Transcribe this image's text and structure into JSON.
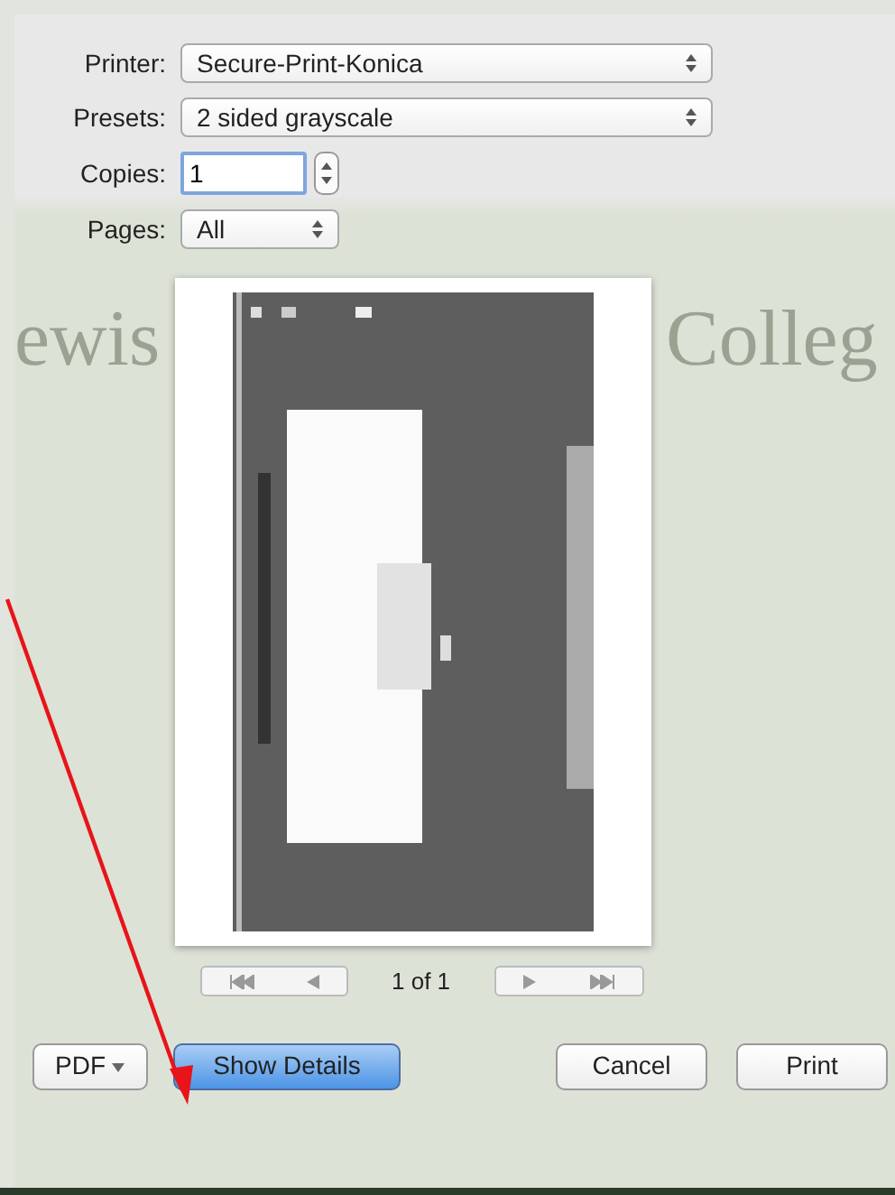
{
  "fields": [
    {
      "kind": "select",
      "label": "Printer:",
      "value": "Secure-Print-Konica",
      "wide": true
    },
    {
      "kind": "select",
      "label": "Presets:",
      "value": "2 sided grayscale",
      "wide": true
    },
    {
      "kind": "number",
      "label": "Copies:",
      "value": "1"
    },
    {
      "kind": "select",
      "label": "Pages:",
      "value": "All",
      "wide": false
    }
  ],
  "background_heading": {
    "left": "ewis",
    "right": "Colleg"
  },
  "preview": {
    "kind": "picture",
    "page_indicator": "1 of 1"
  },
  "buttons": [
    {
      "label": "PDF",
      "kind": "menu"
    },
    {
      "label": "Show Details",
      "kind": "default"
    },
    {
      "label": "Cancel",
      "kind": "normal"
    },
    {
      "label": "Print",
      "kind": "normal"
    }
  ]
}
